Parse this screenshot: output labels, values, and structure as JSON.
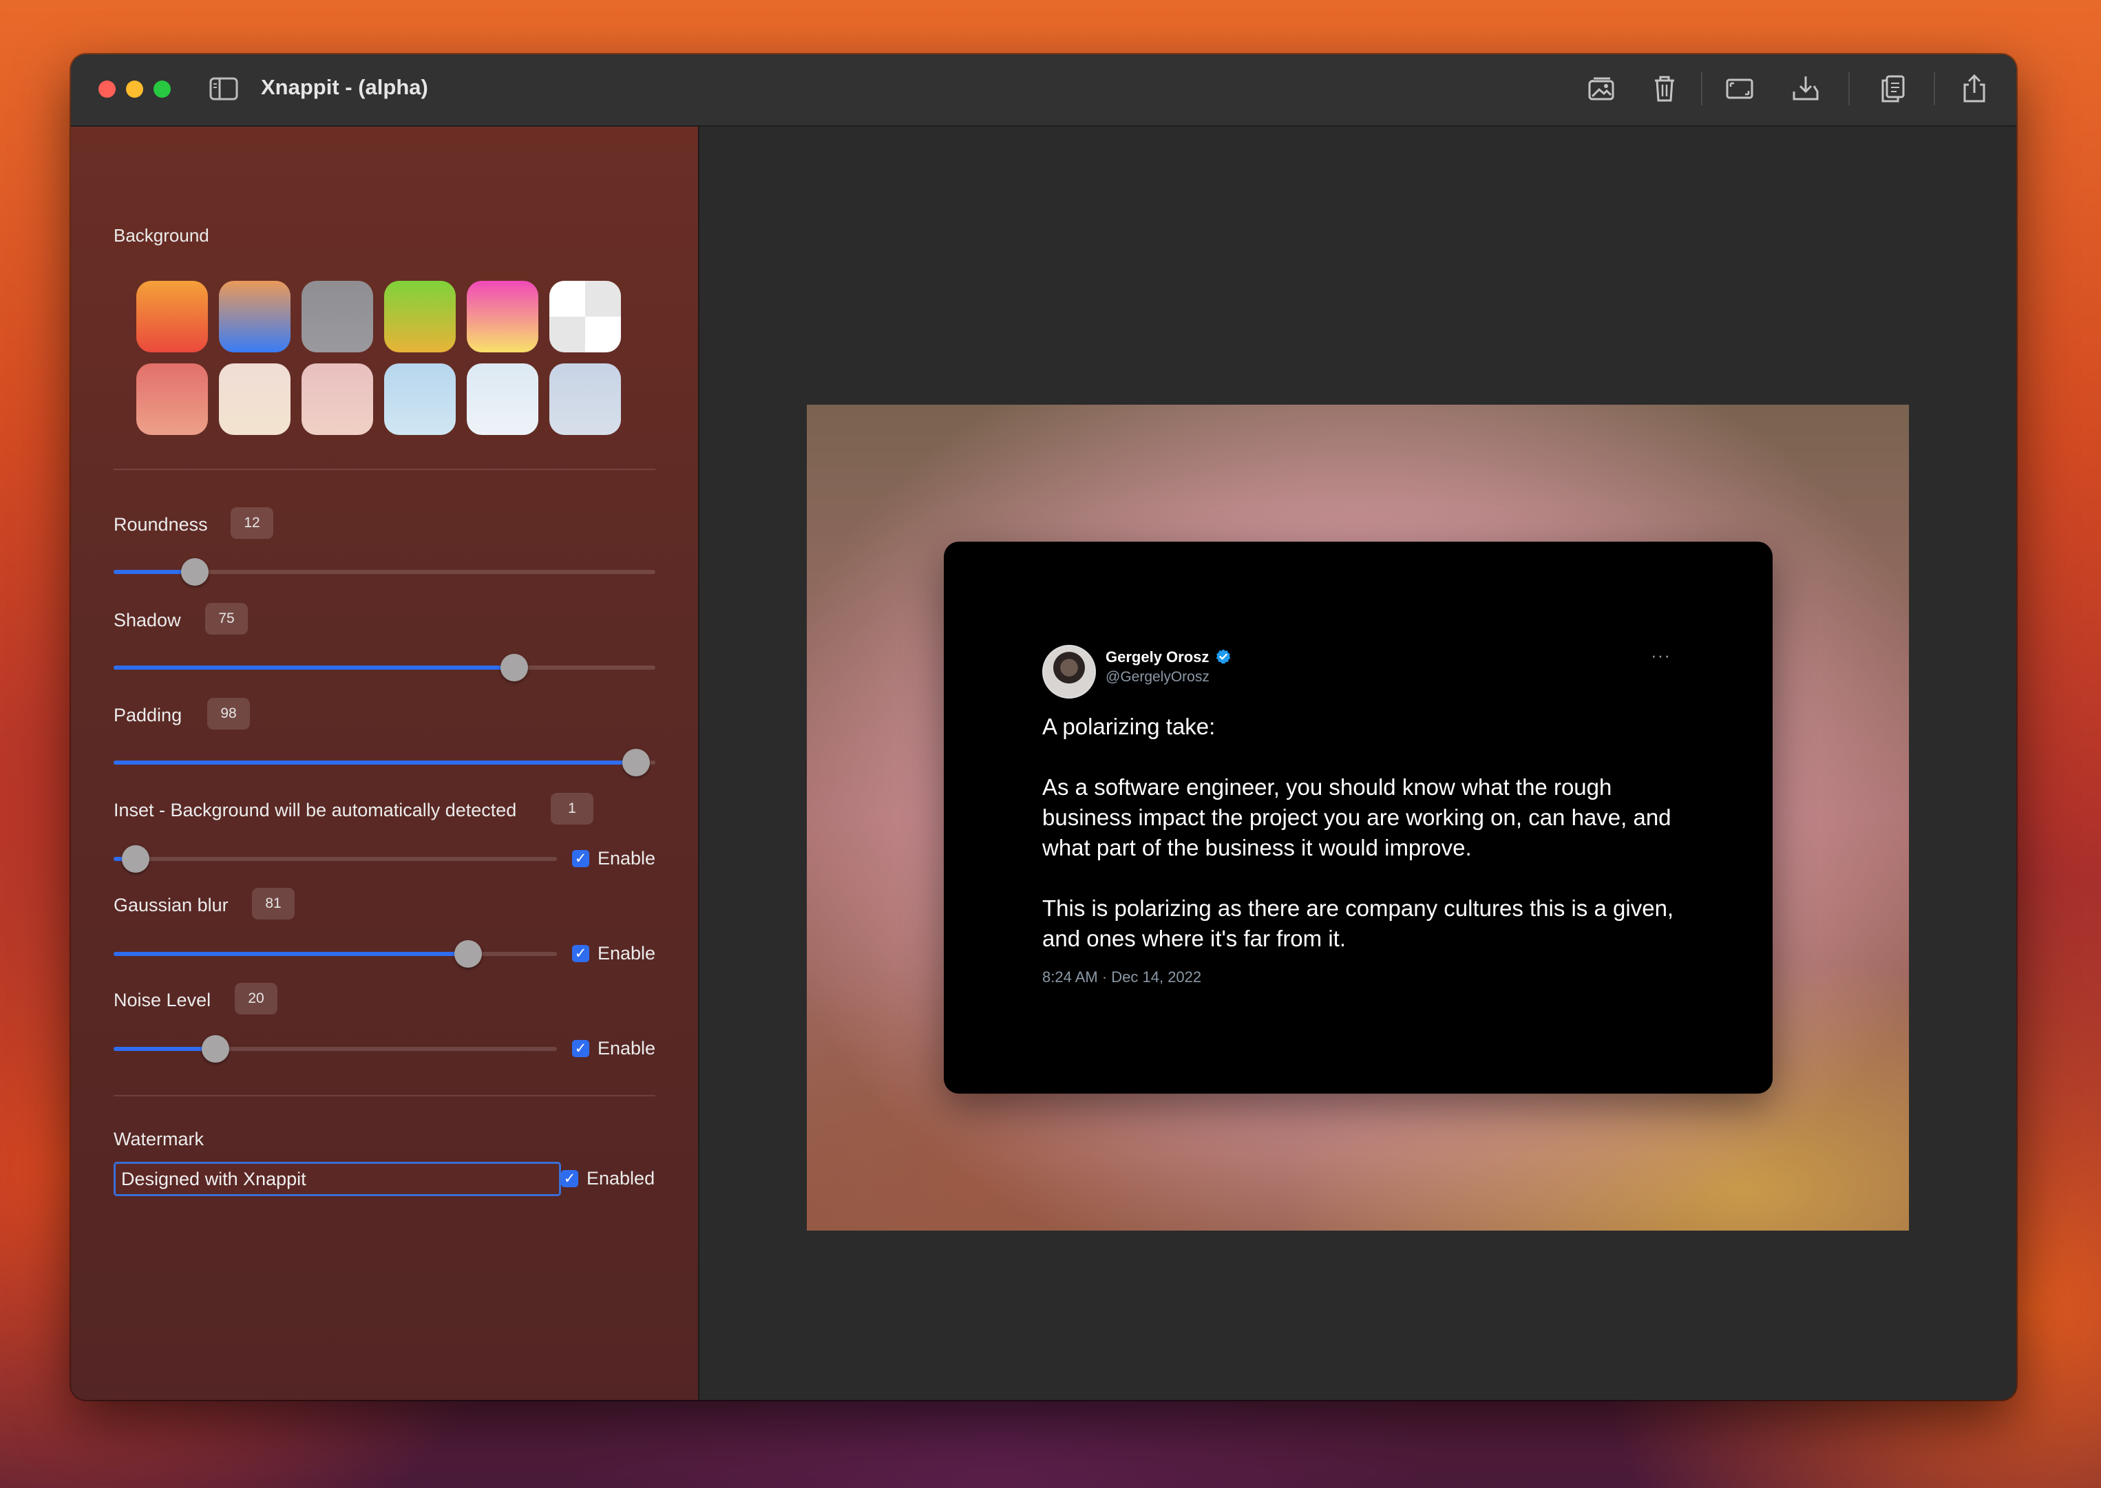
{
  "window": {
    "title": "Xnappit - (alpha)",
    "toolbar_icons": [
      "add-image-icon",
      "trash-icon",
      "crop-icon",
      "save-icon",
      "copy-icon",
      "share-icon"
    ]
  },
  "sidebar": {
    "background": {
      "label": "Background",
      "swatches": [
        {
          "name": "orange-red-gradient",
          "colors": [
            "#f4a03a",
            "#ea4a3c"
          ]
        },
        {
          "name": "orange-blue-gradient",
          "colors": [
            "#e99a5a",
            "#3a7cf5"
          ]
        },
        {
          "name": "gray",
          "colors": [
            "#8f8e92",
            "#9a999d"
          ]
        },
        {
          "name": "green-yellow-gradient",
          "colors": [
            "#7fd23a",
            "#e7b338"
          ]
        },
        {
          "name": "pink-yellow-gradient",
          "colors": [
            "#f04ab8",
            "#f8e06a"
          ]
        },
        {
          "name": "checker-white",
          "colors": [
            "#ffffff",
            "#e6e6e6"
          ]
        },
        {
          "name": "salmon",
          "colors": [
            "#e2706a",
            "#eda08a"
          ]
        },
        {
          "name": "cream",
          "colors": [
            "#f0ddd5",
            "#f3e3cf"
          ]
        },
        {
          "name": "blush",
          "colors": [
            "#e8c0c0",
            "#f0d0c5"
          ]
        },
        {
          "name": "light-blue",
          "colors": [
            "#b7d6ee",
            "#d0e6f3"
          ]
        },
        {
          "name": "pale-blue",
          "colors": [
            "#dde9f3",
            "#eef3f8"
          ]
        },
        {
          "name": "periwinkle",
          "colors": [
            "#c7d3e5",
            "#d7dfea"
          ]
        }
      ]
    },
    "roundness": {
      "label": "Roundness",
      "value": "12",
      "fraction": 0.15
    },
    "shadow": {
      "label": "Shadow",
      "value": "75",
      "fraction": 0.74
    },
    "padding": {
      "label": "Padding",
      "value": "98",
      "fraction": 0.965
    },
    "inset": {
      "label": "Inset - Background will be automatically detected",
      "value": "1",
      "fraction": 0.05,
      "enable_label": "Enable",
      "enabled": true
    },
    "gaussian_blur": {
      "label": "Gaussian blur",
      "value": "81",
      "fraction": 0.8,
      "enable_label": "Enable",
      "enabled": true
    },
    "noise_level": {
      "label": "Noise Level",
      "value": "20",
      "fraction": 0.23,
      "enable_label": "Enable",
      "enabled": true
    },
    "watermark": {
      "label": "Watermark",
      "value": "Designed with Xnappit",
      "enabled_label": "Enabled",
      "enabled": true
    }
  },
  "tweet": {
    "author_name": "Gergely Orosz",
    "handle": "@GergelyOrosz",
    "paragraphs": [
      "A polarizing take:",
      "As a software engineer, you should know what the rough business impact the project you are working on, can have, and what part of the business it would improve.",
      "This is polarizing as there are company cultures this is a given, and ones where it's far from it."
    ],
    "timestamp": "8:24 AM · Dec 14, 2022",
    "more": "···"
  },
  "colors": {
    "accent": "#2f6df0",
    "sidebar_bg": "#5c2a25",
    "canvas_bg": "#2b2b2b",
    "verified": "#1d9bf0"
  }
}
